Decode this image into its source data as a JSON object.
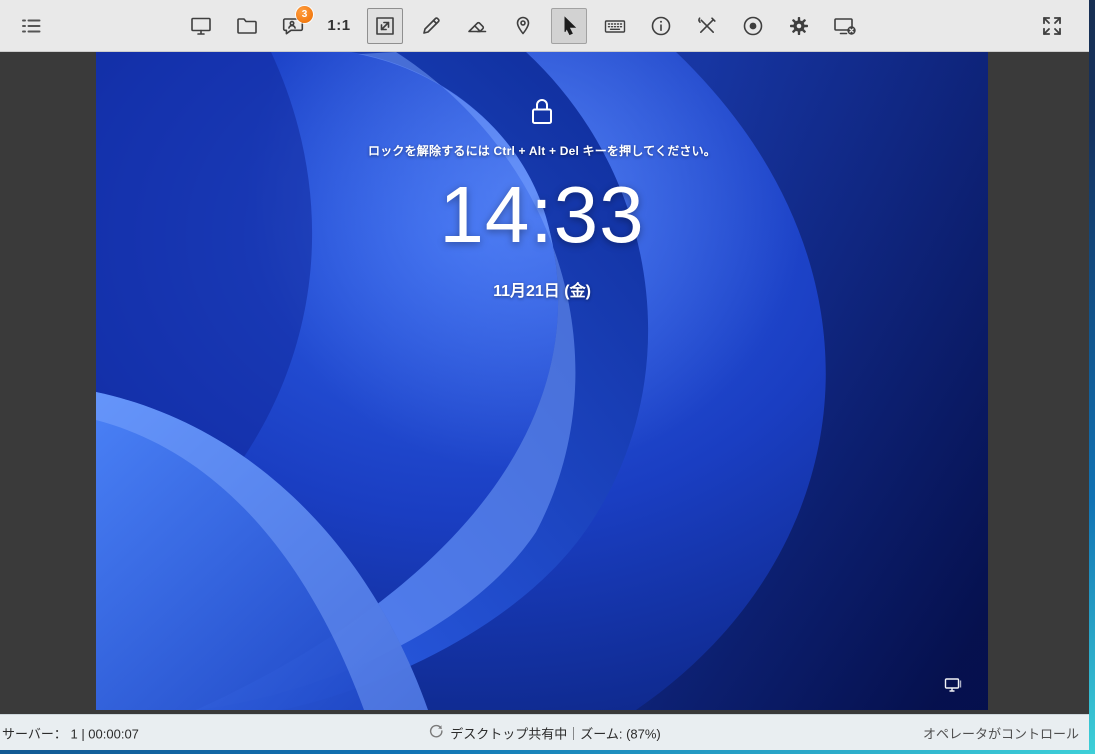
{
  "toolbar": {
    "scale_label": "1:1",
    "badge_count": "3",
    "icons": [
      "menu-list",
      "monitor",
      "folder",
      "chat",
      "scale-1-1",
      "fit-to-window",
      "pencil",
      "eraser",
      "pin",
      "cursor",
      "keyboard",
      "info",
      "tools",
      "record",
      "settings",
      "disconnect-monitor",
      "fullscreen"
    ],
    "active_tools": [
      "fit-to-window",
      "cursor"
    ]
  },
  "remote_screen": {
    "lock_instruction": "ロックを解除するには Ctrl + Alt + Del キーを押してください。",
    "time": "14:33",
    "date": "11月21日 (金)"
  },
  "status_bar": {
    "left": "サーバー： 1 | 00:00:07",
    "center": "デスクトップ共有中｜ズーム: (87%)",
    "right": "オペレータがコントロール"
  },
  "colors": {
    "toolbar_bg": "#e9e9e9",
    "viewport_bg": "#3a3a3a",
    "statusbar_bg": "#e9eef1",
    "badge_orange": "#ee6e00",
    "wallpaper_blue": "#1a3ec2",
    "edge_strip_teal": "#3ed0d8"
  }
}
